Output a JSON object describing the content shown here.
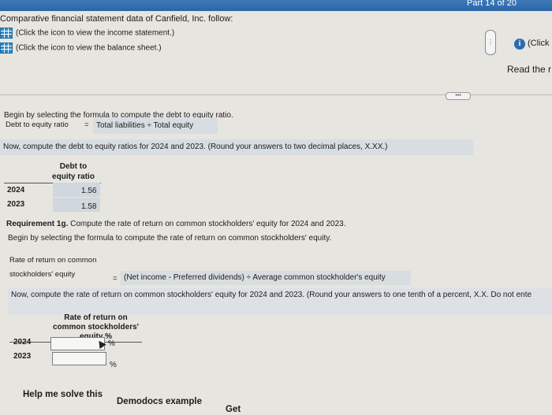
{
  "header": {
    "progress": "Part 14 of 20",
    "intro": "Comparative financial statement data of Canfield, Inc. follow:",
    "income_link": "(Click the icon to view the income statement.)",
    "balance_link": "(Click the icon to view the balance sheet.)",
    "info_label": "(Click",
    "read_more": "Read the r"
  },
  "debt_section": {
    "instruction": "Begin by selecting the formula to compute the debt to equity ratio.",
    "formula_label": "Debt to equity ratio",
    "equals": "=",
    "formula_value": "Total liabilities ÷ Total equity",
    "compute_instruction": "Now, compute the debt to equity ratios for 2024 and 2023. (Round your answers to two decimal places, X.XX.)",
    "col_header_line1": "Debt to",
    "col_header_line2": "equity ratio",
    "rows": [
      {
        "year": "2024",
        "value": "1.56"
      },
      {
        "year": "2023",
        "value": "1.58"
      }
    ]
  },
  "roe_section": {
    "requirement_label": "Requirement 1g.",
    "requirement_text": " Compute the rate of return on common stockholders' equity for 2024 and 2023.",
    "instruction": "Begin by selecting the formula to compute the rate of return on common stockholders' equity.",
    "formula_label_line1": "Rate of return on common",
    "formula_label_line2": "stockholders' equity",
    "equals": "=",
    "formula_value": "(Net income - Preferred dividends) ÷ Average common stockholder's equity",
    "compute_instruction": "Now, compute the rate of return on common stockholders' equity for 2024 and 2023. (Round your answers to one tenth of a percent, X.X. Do not ente",
    "col_header_line1": "Rate of return on",
    "col_header_line2": "common stockholders'",
    "col_header_line3": "equity %",
    "rows": [
      {
        "year": "2024",
        "value": "",
        "unit": "%"
      },
      {
        "year": "2023",
        "value": "",
        "unit": "%"
      }
    ]
  },
  "footer": {
    "help_button": "Help me solve this",
    "demodocs_button": "Demodocs example",
    "get_more": "Get"
  },
  "colors": {
    "topbar": "#2c66a7",
    "answer_fill": "#d0d7dd"
  }
}
